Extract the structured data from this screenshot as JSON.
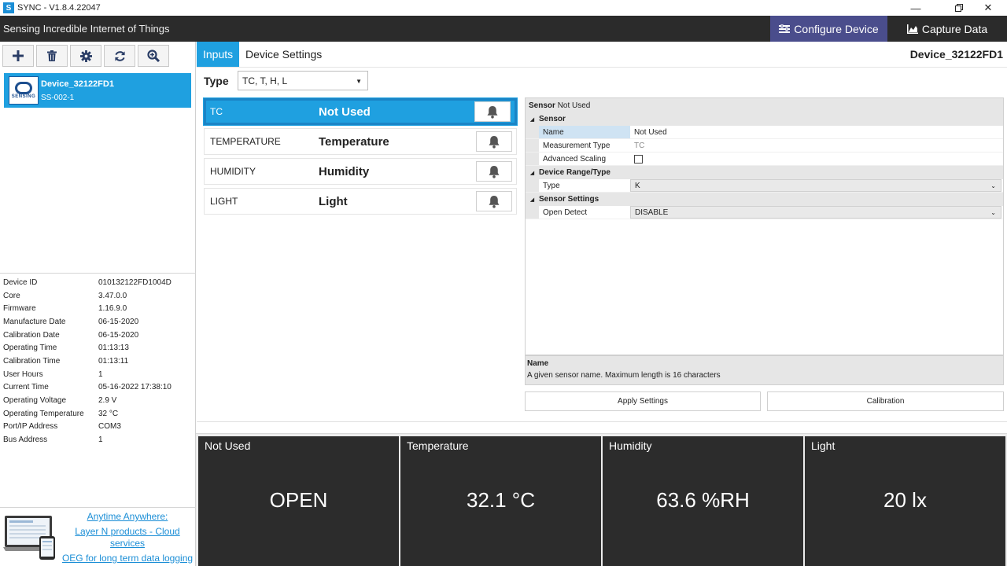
{
  "window": {
    "title": "SYNC - V1.8.4.22047",
    "app_icon": "S"
  },
  "header": {
    "brand": "Sensing Incredible Internet of Things",
    "configure_label": "Configure Device",
    "capture_label": "Capture Data"
  },
  "toolbar": {
    "icons": [
      "plus-icon",
      "trash-icon",
      "gear-icon",
      "refresh-icon",
      "zoom-icon"
    ]
  },
  "device": {
    "name": "Device_32122FD1",
    "model": "SS-002-1",
    "logo_text": "SENSING"
  },
  "device_info": [
    {
      "key": "Device ID",
      "value": "010132122FD1004D"
    },
    {
      "key": "Core",
      "value": "3.47.0.0"
    },
    {
      "key": "Firmware",
      "value": "1.16.9.0"
    },
    {
      "key": "Manufacture Date",
      "value": "06-15-2020"
    },
    {
      "key": "Calibration Date",
      "value": "06-15-2020"
    },
    {
      "key": "Operating Time",
      "value": "01:13:13"
    },
    {
      "key": "Calibration Time",
      "value": "01:13:11"
    },
    {
      "key": "User Hours",
      "value": "1"
    },
    {
      "key": "Current Time",
      "value": "05-16-2022 17:38:10"
    },
    {
      "key": "Operating Voltage",
      "value": "2.9 V"
    },
    {
      "key": "Operating Temperature",
      "value": "32 °C"
    },
    {
      "key": "Port/IP Address",
      "value": "COM3"
    },
    {
      "key": "Bus Address",
      "value": "1"
    }
  ],
  "promo": {
    "line1": "Anytime Anywhere:",
    "line2": "Layer N products - Cloud",
    "line3": "services",
    "line4": "OEG for long term data logging"
  },
  "tabs": {
    "inputs": "Inputs",
    "device_settings": "Device Settings"
  },
  "main": {
    "device_title": "Device_32122FD1",
    "type_label": "Type",
    "type_value": "TC, T, H, L"
  },
  "sensors": [
    {
      "code": "TC",
      "name": "Not Used"
    },
    {
      "code": "TEMPERATURE",
      "name": "Temperature"
    },
    {
      "code": "HUMIDITY",
      "name": "Humidity"
    },
    {
      "code": "LIGHT",
      "name": "Light"
    }
  ],
  "properties": {
    "header_label": "Sensor",
    "header_value": "Not Used",
    "cat_sensor": "Sensor",
    "name_key": "Name",
    "name_val": "Not Used",
    "mtype_key": "Measurement Type",
    "mtype_val": "TC",
    "adv_key": "Advanced Scaling",
    "cat_range": "Device Range/Type",
    "type_key": "Type",
    "type_val": "K",
    "cat_settings": "Sensor Settings",
    "open_key": "Open Detect",
    "open_val": "DISABLE",
    "desc_title": "Name",
    "desc_text": "A given sensor name. Maximum length is 16 characters"
  },
  "actions": {
    "apply": "Apply Settings",
    "calibration": "Calibration"
  },
  "tiles": [
    {
      "title": "Not Used",
      "value": "OPEN"
    },
    {
      "title": "Temperature",
      "value": "32.1 °C"
    },
    {
      "title": "Humidity",
      "value": "63.6 %RH"
    },
    {
      "title": "Light",
      "value": "20 lx"
    }
  ],
  "colors": {
    "accent": "#1fa0e0",
    "topbar": "#2b2b2b",
    "active_nav": "#4a4d8c",
    "tile": "#2c2c2c"
  }
}
